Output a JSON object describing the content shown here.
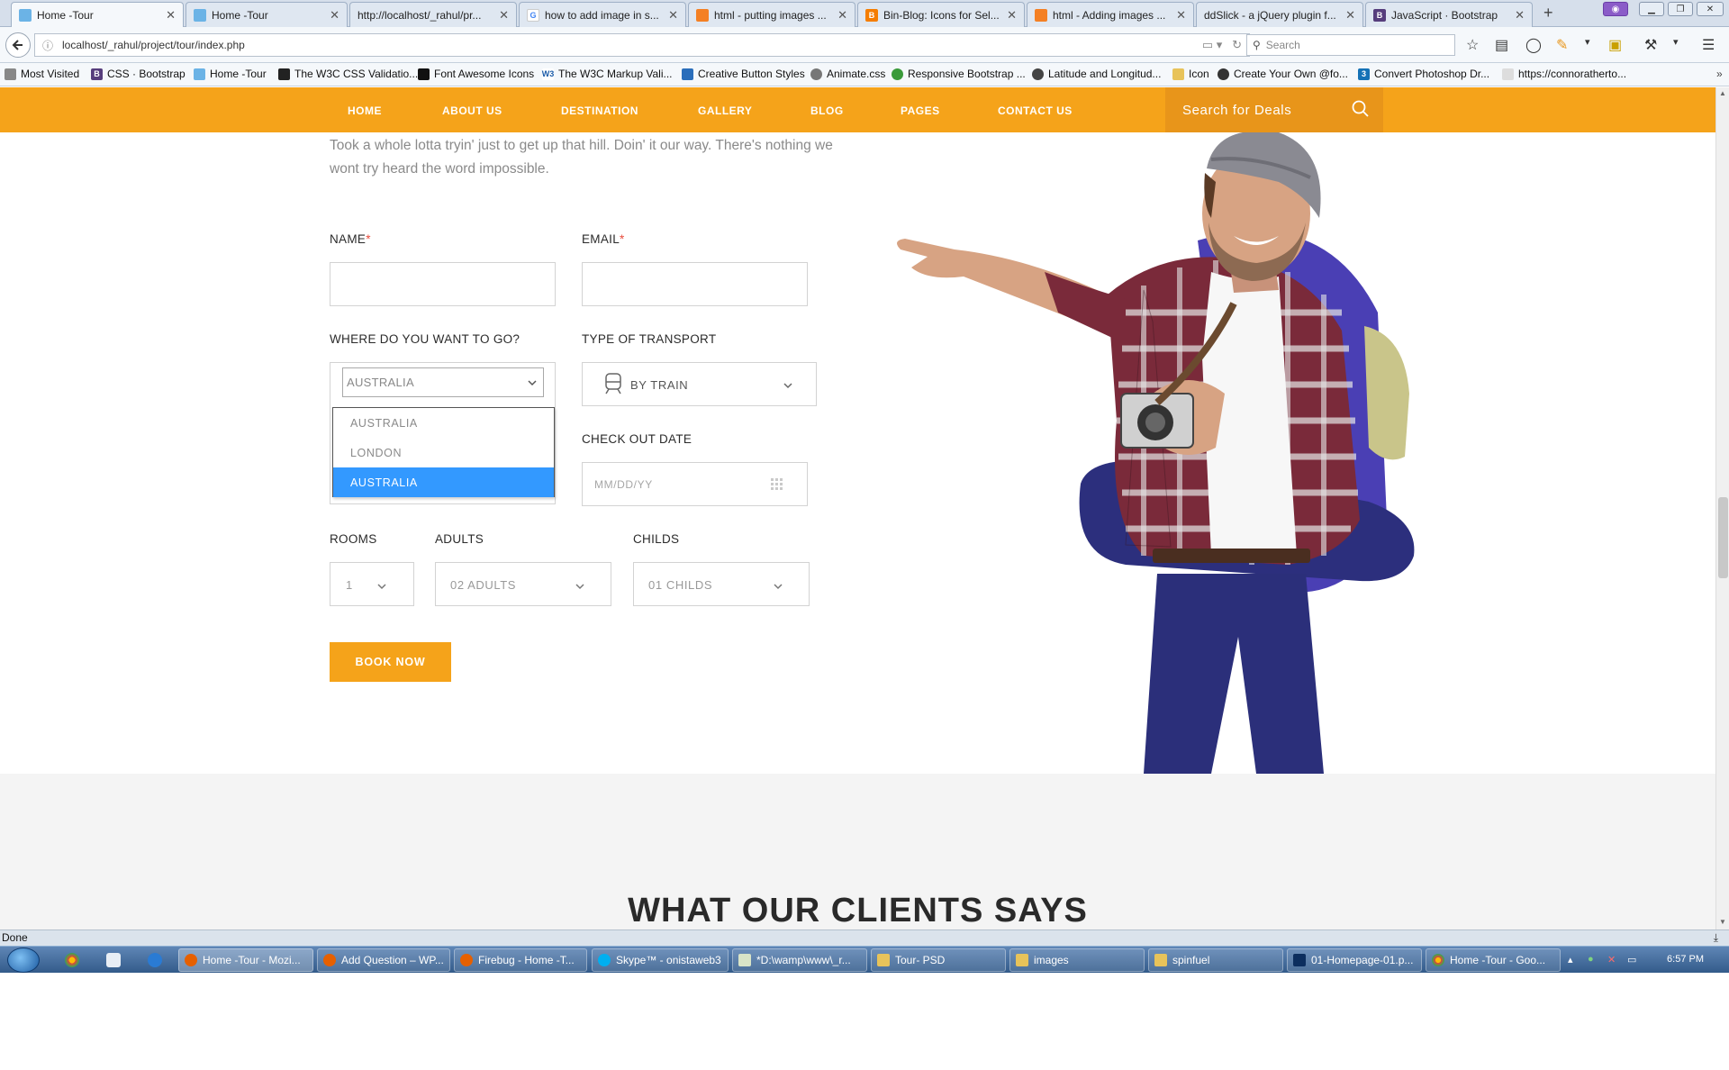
{
  "browser": {
    "tabs": [
      {
        "title": "Home -Tour",
        "active": true,
        "icon": "hummingbird-icon"
      },
      {
        "title": "Home -Tour",
        "active": false,
        "icon": "hummingbird-icon"
      },
      {
        "title": "http://localhost/_rahul/pr...",
        "active": false,
        "icon": "blank-page-icon"
      },
      {
        "title": "how to add image in s...",
        "active": false,
        "icon": "google-icon"
      },
      {
        "title": "html - putting images ...",
        "active": false,
        "icon": "stackoverflow-icon"
      },
      {
        "title": "Bin-Blog: Icons for Sel...",
        "active": false,
        "icon": "blogger-icon"
      },
      {
        "title": "html - Adding images ...",
        "active": false,
        "icon": "stackoverflow-icon"
      },
      {
        "title": "ddSlick - a jQuery plugin f...",
        "active": false,
        "icon": "blank-page-icon"
      },
      {
        "title": "JavaScript · Bootstrap",
        "active": false,
        "icon": "bootstrap-icon"
      }
    ],
    "new_tab": "+",
    "url": "localhost/_rahul/project/tour/index.php",
    "search_placeholder": "Search",
    "bookmarks": [
      {
        "label": "Most Visited",
        "icon": "gear-icon"
      },
      {
        "label": "CSS · Bootstrap",
        "icon": "bootstrap-icon"
      },
      {
        "label": "Home -Tour",
        "icon": "hummingbird-icon"
      },
      {
        "label": "The W3C CSS Validatio...",
        "icon": "w3c-icon"
      },
      {
        "label": "Font Awesome Icons",
        "icon": "flag-icon"
      },
      {
        "label": "The W3C Markup Vali...",
        "icon": "w3c-icon"
      },
      {
        "label": "Creative Button Styles",
        "icon": "codrops-icon"
      },
      {
        "label": "Animate.css",
        "icon": "globe-icon"
      },
      {
        "label": "Responsive Bootstrap ...",
        "icon": "globe-icon"
      },
      {
        "label": "Latitude and Longitud...",
        "icon": "compass-icon"
      },
      {
        "label": "Icon",
        "icon": "folder-icon"
      },
      {
        "label": "Create Your Own @fo...",
        "icon": "avatar-icon"
      },
      {
        "label": "Convert Photoshop Dr...",
        "icon": "css3-icon"
      },
      {
        "label": "https://connoratherto...",
        "icon": "blank-page-icon"
      }
    ],
    "status": "Done"
  },
  "site": {
    "nav": [
      "HOME",
      "ABOUT US",
      "DESTINATION",
      "GALLERY",
      "BLOG",
      "PAGES",
      "CONTACT US"
    ],
    "search_placeholder": "Search for Deals",
    "intro": "Took a whole lotta tryin' just to get up that hill. Doin' it our way. There's nothing we wont try heard the word impossible.",
    "form": {
      "name_label": "NAME",
      "email_label": "EMAIL",
      "required_mark": "*",
      "where_label": "WHERE DO YOU WANT TO GO?",
      "where_value": "AUSTRALIA",
      "where_options": [
        "AUSTRALIA",
        "LONDON",
        "AUSTRALIA"
      ],
      "where_selected_index": 2,
      "transport_label": "TYPE OF TRANSPORT",
      "transport_value": "BY TRAIN",
      "checkout_label": "CHECK OUT DATE",
      "checkout_placeholder": "MM/DD/YY",
      "rooms_label": "ROOMS",
      "rooms_value": "1",
      "adults_label": "ADULTS",
      "adults_value": "02 ADULTS",
      "childs_label": "CHILDS",
      "childs_value": "01 CHILDS",
      "book_button": "BOOK NOW"
    },
    "clients_title": "WHAT OUR CLIENTS SAYS",
    "accent_color": "#f5a31a"
  },
  "taskbar": {
    "items": [
      {
        "label": "Home -Tour - Mozi...",
        "active": true
      },
      {
        "label": "Add Question – WP...",
        "active": false
      },
      {
        "label": "Firebug - Home -T...",
        "active": false
      },
      {
        "label": "Skype™ - onistaweb3",
        "active": false
      },
      {
        "label": "*D:\\wamp\\www\\_r...",
        "active": false
      },
      {
        "label": "Tour- PSD",
        "active": false
      },
      {
        "label": "images",
        "active": false
      },
      {
        "label": "spinfuel",
        "active": false
      },
      {
        "label": "01-Homepage-01.p...",
        "active": false
      },
      {
        "label": "Home -Tour - Goo...",
        "active": false
      }
    ],
    "clock": "6:57 PM"
  }
}
